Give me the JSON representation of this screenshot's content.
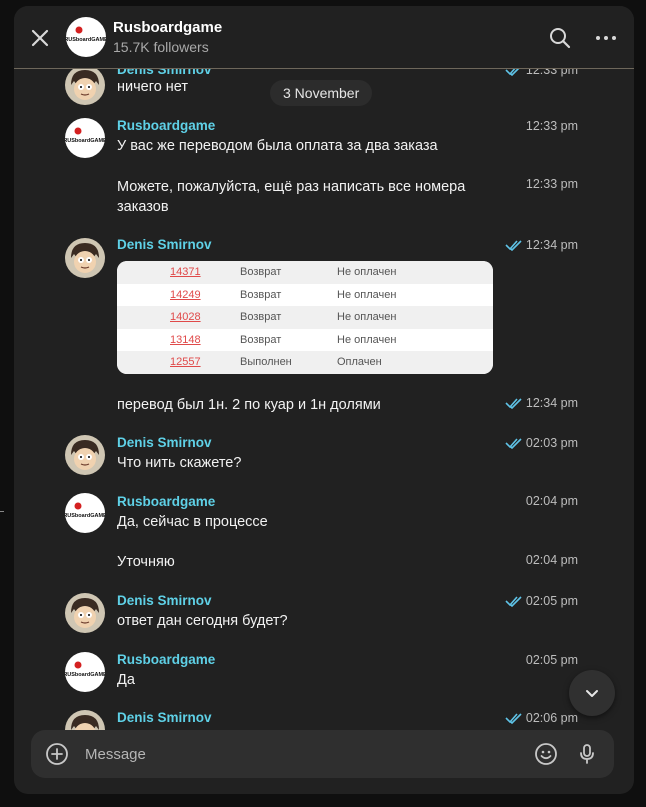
{
  "header": {
    "channel_name": "Rusboardgame",
    "followers": "15.7K followers"
  },
  "brand": {
    "logo_text": "RUSboardGAME",
    "logo_dot_color": "#d42020",
    "sender_color": "#5fd1e7",
    "read_check_color": "#5fc4e8"
  },
  "date_separator": "3 November",
  "messages": [
    {
      "sender": "Denis Smirnov",
      "text": "ничего нет",
      "time": "12:33 pm",
      "read": true
    },
    {
      "sender": "Rusboardgame",
      "text": "У вас же переводом была оплата за два заказа",
      "time": "12:33 pm",
      "read": false
    },
    {
      "sender": "",
      "text": "Можете, пожалуйста, ещё раз написать все номера заказов",
      "time": "12:33 pm",
      "read": false
    },
    {
      "sender": "Denis Smirnov",
      "text": "",
      "time": "12:34 pm",
      "read": true
    },
    {
      "sender": "",
      "text": "перевод был 1н. 2 по куар и 1н долями",
      "time": "12:34 pm",
      "read": true
    },
    {
      "sender": "Denis Smirnov",
      "text": "Что нить скажете?",
      "time": "02:03 pm",
      "read": true
    },
    {
      "sender": "Rusboardgame",
      "text": "Да, сейчас в процессе",
      "time": "02:04 pm",
      "read": false
    },
    {
      "sender": "",
      "text": "Уточняю",
      "time": "02:04 pm",
      "read": false
    },
    {
      "sender": "Denis Smirnov",
      "text": "ответ дан сегодня будет?",
      "time": "02:05 pm",
      "read": true
    },
    {
      "sender": "Rusboardgame",
      "text": "Да",
      "time": "02:05 pm",
      "read": false
    },
    {
      "sender": "Denis Smirnov",
      "text": "",
      "time": "02:06 pm",
      "read": true
    }
  ],
  "orders": [
    {
      "id": "14371",
      "status": "Возврат",
      "payment": "Не оплачен"
    },
    {
      "id": "14249",
      "status": "Возврат",
      "payment": "Не оплачен"
    },
    {
      "id": "14028",
      "status": "Возврат",
      "payment": "Не оплачен"
    },
    {
      "id": "13148",
      "status": "Возврат",
      "payment": "Не оплачен"
    },
    {
      "id": "12557",
      "status": "Выполнен",
      "payment": "Оплачен"
    }
  ],
  "composer": {
    "placeholder": "Message"
  },
  "icons": {
    "close": "close-icon",
    "search": "search-icon",
    "more": "more-vertical-icon",
    "add": "add-circle-icon",
    "emoji": "emoji-icon",
    "mic": "microphone-icon",
    "scroll": "chevron-down-icon"
  }
}
